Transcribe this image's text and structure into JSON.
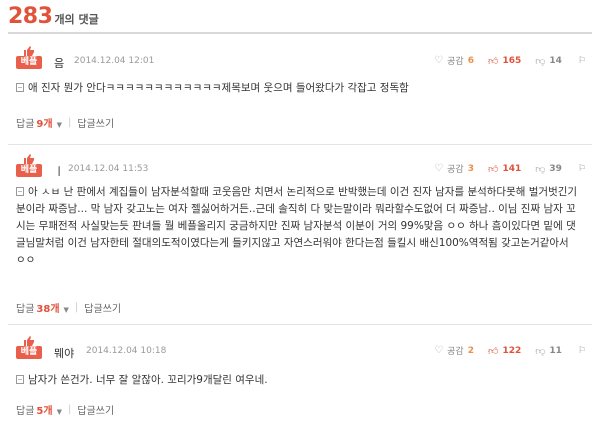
{
  "header": {
    "count": "283",
    "label": "개의 댓글"
  },
  "comments": [
    {
      "best_label": "베플",
      "nick": "음",
      "date": "2014.12.04 12:01",
      "agree_label": "공감",
      "agree": "6",
      "likes": "165",
      "dislikes": "14",
      "text": "애 진자 뭔가 안다ㅋㅋㅋㅋㅋㅋㅋㅋㅋㅋㅋㅋ제목보며 웃으며 들어왔다가 각잡고 정독함",
      "reply_label": "답글",
      "reply_count": "9개",
      "write_label": "답글쓰기"
    },
    {
      "best_label": "베플",
      "nick": "ㅣ",
      "date": "2014.12.04 11:53",
      "agree_label": "공감",
      "agree": "3",
      "likes": "141",
      "dislikes": "39",
      "text": "아 ㅅㅂ 난 판에서 계집들이 남자분석할때 코웃음만 치면서 논리적으로 반박했는데 이건 진자 남자를 분석하다못해 벌거벗긴기분이라 짜증남... 막 남자 갖고노는 여자 젤싫어하거든..근데 솔직히 다 맞는말이라 뭐라할수도없어 더 짜증남.. 이님 진짜 남자 꼬시는 무패전적 사실맞는듯 판녀들 뭘 베플올리지 궁금하지만 진짜 남자분석 이분이 거의 99%맞음 ㅇㅇ 하나 흠이있다면 밑에 댓글님말처럼 이건 남자한테 절대의도적이였다는게 들키지않고 자연스러워야 한다는점 들킬시 배신100%역적됨 갖고논거같아서 ㅇㅇ",
      "reply_label": "답글",
      "reply_count": "38개",
      "write_label": "답글쓰기"
    },
    {
      "best_label": "베플",
      "nick": "뭬야",
      "date": "2014.12.04 10:18",
      "agree_label": "공감",
      "agree": "2",
      "likes": "122",
      "dislikes": "11",
      "text": "남자가 쓴건가. 너무 잘 알잖아. 꼬리가9개달린 여우네.",
      "reply_label": "답글",
      "reply_count": "5개",
      "write_label": "답글쓰기"
    }
  ],
  "colors": {
    "accent": "#e0523a",
    "best_badge": "#e8604c",
    "agree": "#e8914c"
  }
}
